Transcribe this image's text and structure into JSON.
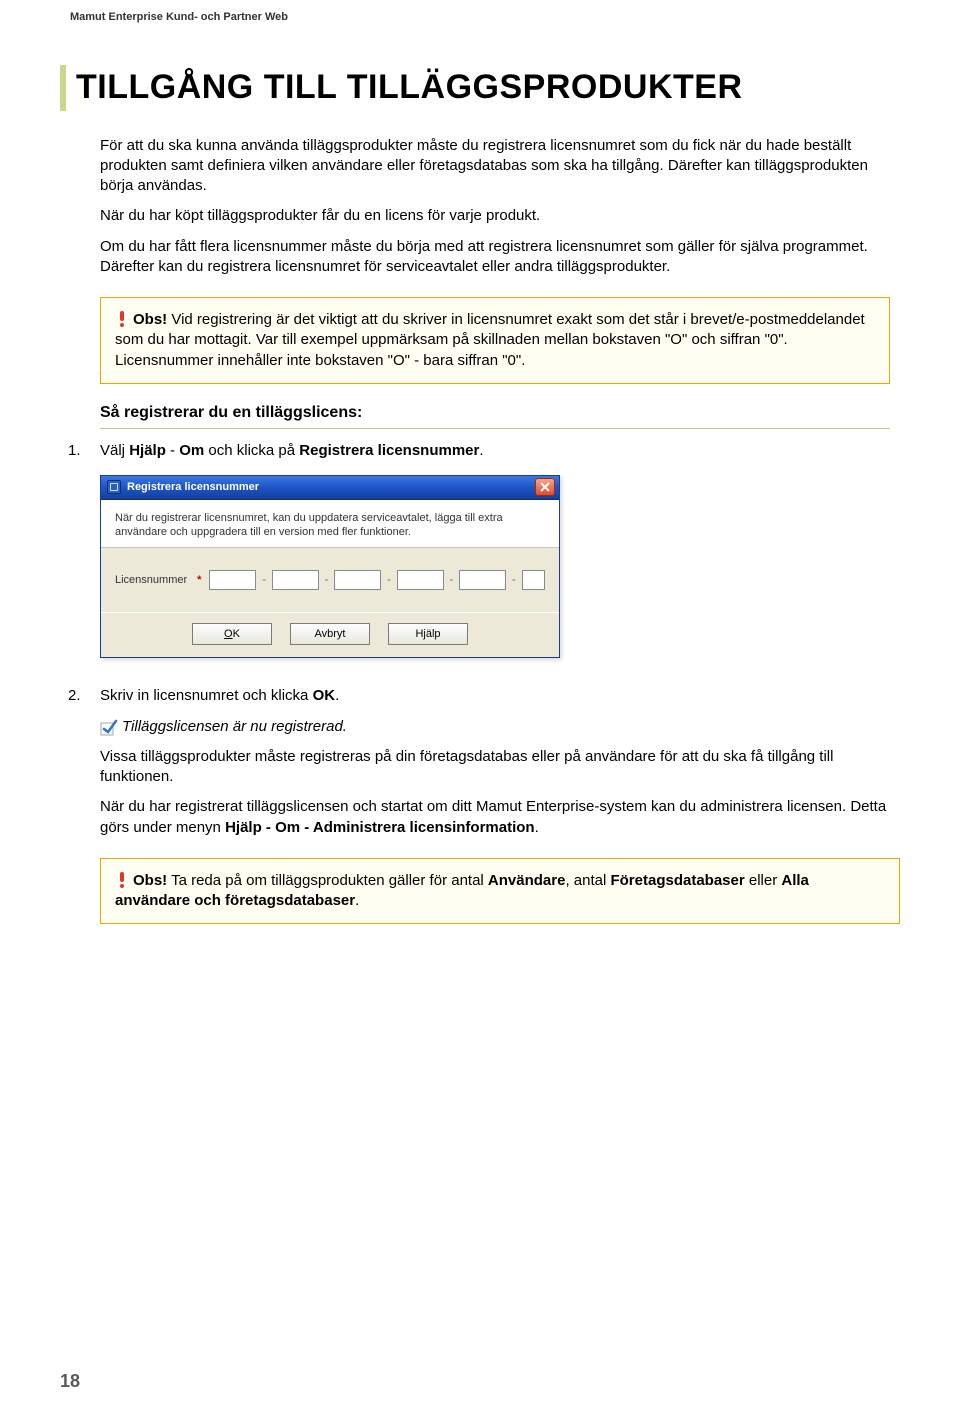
{
  "header": "Mamut Enterprise Kund- och Partner Web",
  "title": "TILLGÅNG TILL TILLÄGGSPRODUKTER",
  "intro": {
    "p1": "För att du ska kunna använda tilläggsprodukter måste du registrera licensnumret som du fick när du hade beställt produkten samt definiera vilken användare eller företagsdatabas som ska ha tillgång. Därefter kan tilläggsprodukten börja användas.",
    "p2": "När du har köpt tilläggsprodukter får du en licens för varje produkt.",
    "p3": "Om du har fått flera licensnummer måste du börja med att registrera licensnumret som gäller för själva programmet. Därefter kan du registrera licensnumret för serviceavtalet eller andra tilläggsprodukter."
  },
  "obs1": {
    "bold": "Obs!",
    "text": " Vid registrering är det viktigt att du skriver in licensnumret exakt som det står i brevet/e-postmeddelandet som du har mottagit. Var till exempel uppmärksam på skillnaden mellan bokstaven \"O\" och siffran \"0\". Licensnummer innehåller inte bokstaven \"O\" - bara siffran \"0\"."
  },
  "subheading": "Så registrerar du en tilläggslicens:",
  "step1": {
    "num": "1.",
    "pre": "Välj ",
    "b1": "Hjälp",
    "mid": " - ",
    "b2": "Om",
    "mid2": " och klicka på ",
    "b3": "Registrera licensnummer",
    "post": "."
  },
  "dialog": {
    "title": "Registrera licensnummer",
    "info": "När du registrerar licensnumret, kan du uppdatera serviceavtalet, lägga till extra användare och uppgradera till en version med fler funktioner.",
    "label": "Licensnummer",
    "req": "*",
    "buttons": {
      "ok": "OK",
      "cancel": "Avbryt",
      "help": "Hjälp"
    }
  },
  "step2": {
    "num": "2.",
    "text_pre": "Skriv in licensnumret och klicka ",
    "text_b": "OK",
    "text_post": ".",
    "confirm": "Tilläggslicensen är nu registrerad.",
    "p1": "Vissa tilläggsprodukter måste registreras på din företagsdatabas eller på användare för att du ska få tillgång till funktionen.",
    "p2_pre": "När du har registrerat tilläggslicensen och startat om ditt Mamut Enterprise-system kan du administrera licensen. Detta görs under menyn ",
    "p2_b": "Hjälp - Om - Administrera licensinformation",
    "p2_post": "."
  },
  "obs2": {
    "bold": "Obs!",
    "pre": " Ta reda på om tilläggsprodukten gäller för antal ",
    "b1": "Användare",
    "mid1": ", antal ",
    "b2": "Företagsdatabaser",
    "mid2": " eller ",
    "b3": "Alla användare och företagsdatabaser",
    "post": "."
  },
  "pageNumber": "18"
}
